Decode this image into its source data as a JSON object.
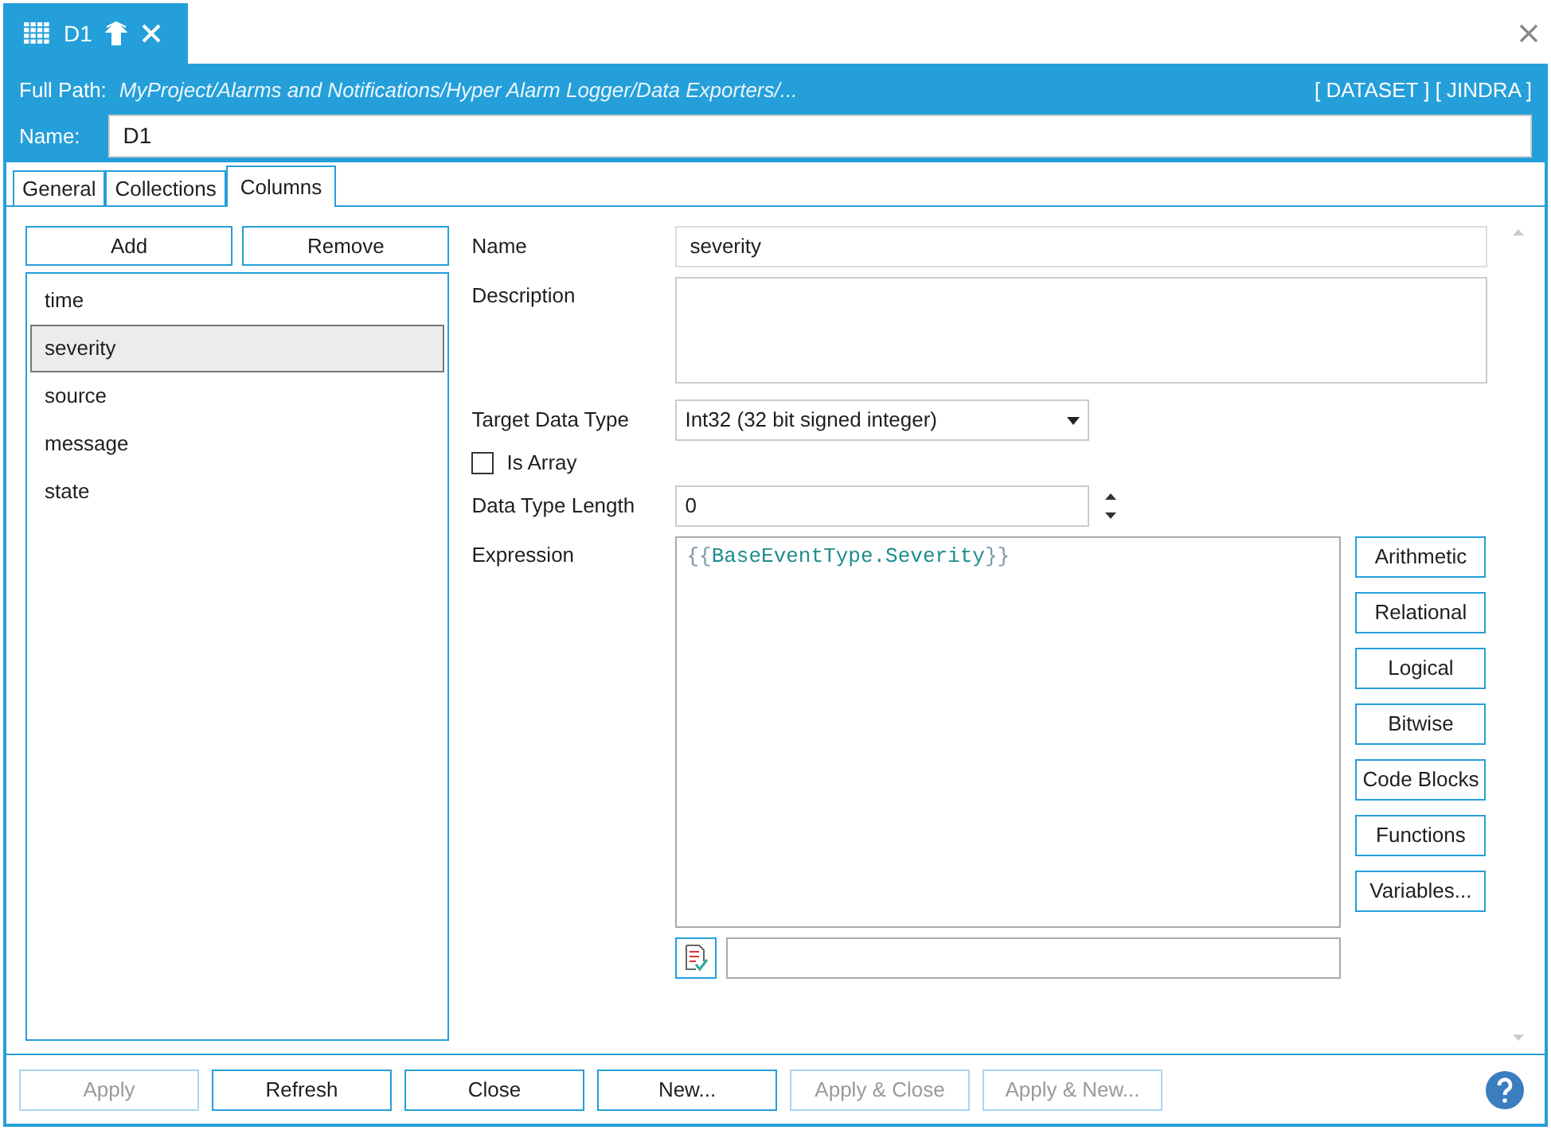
{
  "document_tab": {
    "label": "D1"
  },
  "header": {
    "full_path_label": "Full Path:",
    "full_path": "MyProject/Alarms and Notifications/Hyper Alarm Logger/Data Exporters/...",
    "tags": "[ DATASET ] [ JINDRA ]",
    "name_label": "Name:",
    "name_value": "D1"
  },
  "tabs": [
    {
      "label": "General",
      "selected": false
    },
    {
      "label": "Collections",
      "selected": false
    },
    {
      "label": "Columns",
      "selected": true
    }
  ],
  "column_list": {
    "add": "Add",
    "remove": "Remove",
    "items": [
      {
        "label": "time",
        "selected": false
      },
      {
        "label": "severity",
        "selected": true
      },
      {
        "label": "source",
        "selected": false
      },
      {
        "label": "message",
        "selected": false
      },
      {
        "label": "state",
        "selected": false
      }
    ]
  },
  "form": {
    "name_label": "Name",
    "name_value": "severity",
    "description_label": "Description",
    "target_type_label": "Target Data Type",
    "target_type_value": "Int32 (32 bit signed integer)",
    "is_array": {
      "label": "Is Array",
      "checked": false
    },
    "length_label": "Data Type Length",
    "length_value": "0",
    "expression_label": "Expression",
    "expression": {
      "open": "{{",
      "body": "BaseEventType.Severity",
      "close": "}}"
    }
  },
  "expression_buttons": [
    "Arithmetic",
    "Relational",
    "Logical",
    "Bitwise",
    "Code Blocks",
    "Functions",
    "Variables..."
  ],
  "footer_buttons": [
    {
      "label": "Apply",
      "disabled": true
    },
    {
      "label": "Refresh",
      "disabled": false
    },
    {
      "label": "Close",
      "disabled": false
    },
    {
      "label": "New...",
      "disabled": false
    },
    {
      "label": "Apply & Close",
      "disabled": true
    },
    {
      "label": "Apply & New...",
      "disabled": true
    }
  ]
}
